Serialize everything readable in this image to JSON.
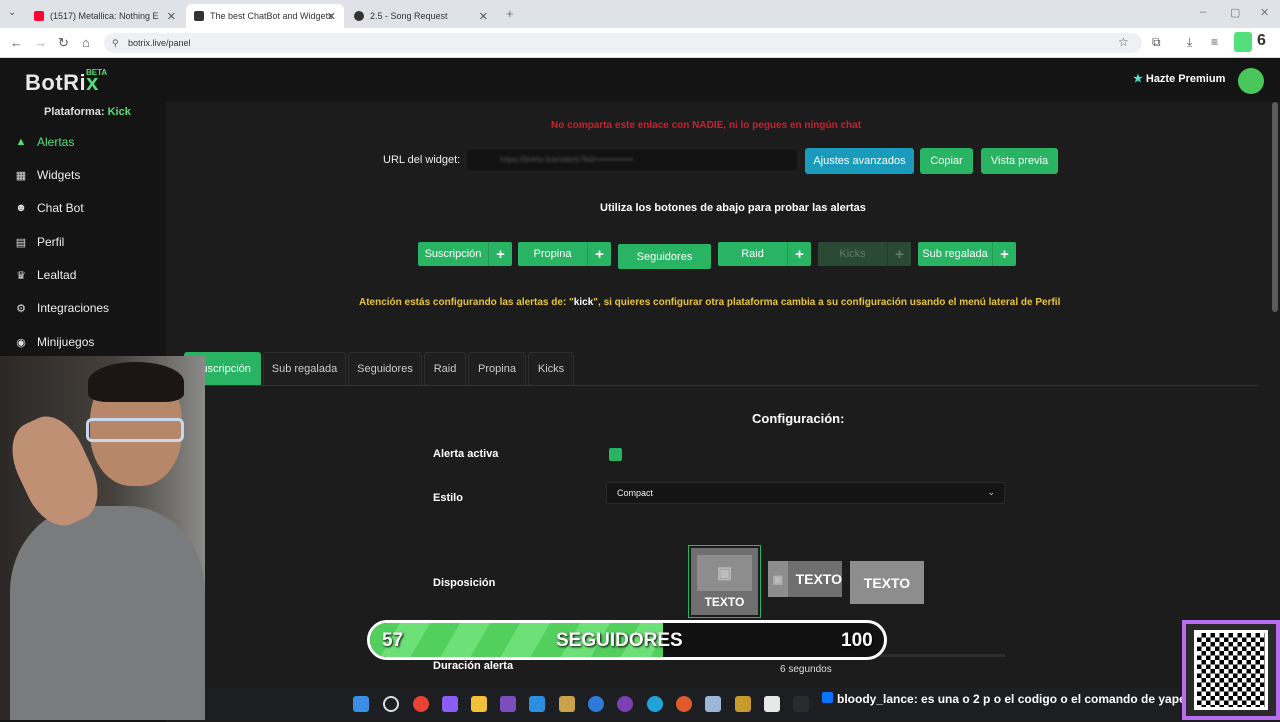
{
  "browser": {
    "tabs": [
      {
        "title": "(1517) Metallica: Nothing E",
        "active": false,
        "favicon_color": "#ff0033"
      },
      {
        "title": "The best ChatBot and Widgets",
        "active": true,
        "favicon_color": "#333333"
      },
      {
        "title": "2.5 - Song Request",
        "active": false,
        "favicon_color": "#333333"
      }
    ],
    "url": "botrix.live/panel",
    "extension_badge": "6"
  },
  "app": {
    "logo": "BotRi",
    "logo_x": "x",
    "beta": "BETA",
    "premium": "Hazte Premium",
    "platform_label": "Plataforma:",
    "platform_value": "Kick"
  },
  "sidebar": {
    "items": [
      {
        "label": "Alertas",
        "icon": "warning-icon",
        "glyph": "▲",
        "active": true
      },
      {
        "label": "Widgets",
        "icon": "grid-icon",
        "glyph": "▦",
        "active": false
      },
      {
        "label": "Chat Bot",
        "icon": "robot-icon",
        "glyph": "☻",
        "active": false
      },
      {
        "label": "Perfil",
        "icon": "id-card-icon",
        "glyph": "▤",
        "active": false
      },
      {
        "label": "Lealtad",
        "icon": "trophy-icon",
        "glyph": "♛",
        "active": false
      },
      {
        "label": "Integraciones",
        "icon": "plug-icon",
        "glyph": "⚙",
        "active": false
      },
      {
        "label": "Minijuegos",
        "icon": "gamepad-icon",
        "glyph": "◉",
        "active": false
      }
    ]
  },
  "main": {
    "warning": "No comparta este enlace con NADIE, ni lo pegues en ningún chat",
    "widget_url_label": "URL del widget:",
    "widget_url_value": "https://botrix.live/alerts?bid=••••••••••••",
    "btn_advanced": "Ajustes avanzados",
    "btn_copy": "Copiar",
    "btn_preview": "Vista previa",
    "hint": "Utiliza los botones de abajo para probar las alertas",
    "test_buttons": [
      {
        "label": "Suscripción",
        "disabled": false
      },
      {
        "label": "Propina",
        "disabled": false
      },
      {
        "label": "Seguidores",
        "disabled": false
      },
      {
        "label": "Raid",
        "disabled": false
      },
      {
        "label": "Kicks",
        "disabled": true
      },
      {
        "label": "Sub regalada",
        "disabled": false
      }
    ],
    "attention_prefix": "Atención estás configurando las alertas de: \"",
    "attention_platform": "kick",
    "attention_suffix": "\", si quieres configurar otra plataforma cambia a su configuración usando el menú lateral de Perfil",
    "tabs": [
      "Suscripción",
      "Sub regalada",
      "Seguidores",
      "Raid",
      "Propina",
      "Kicks"
    ],
    "active_tab": "Suscripción",
    "config_title": "Configuración:",
    "field_active": "Alerta activa",
    "field_style": "Estilo",
    "style_value": "Compact",
    "field_layout": "Disposición",
    "layout_text": "TEXTO",
    "field_duration": "Duración alerta",
    "duration_value": "6 segundos"
  },
  "overlay": {
    "goal_current": "57",
    "goal_label": "SEGUIDORES",
    "goal_target": "100",
    "goal_progress": 0.57,
    "ticker_user": "bloody_lance",
    "ticker_text": ": es una o 2 p o el codigo o el comando de yape"
  },
  "colors": {
    "accent": "#28b463",
    "logo_green": "#53e07a",
    "info_blue": "#1b9bbb",
    "danger": "#c6222e",
    "warning": "#e8c53b"
  }
}
